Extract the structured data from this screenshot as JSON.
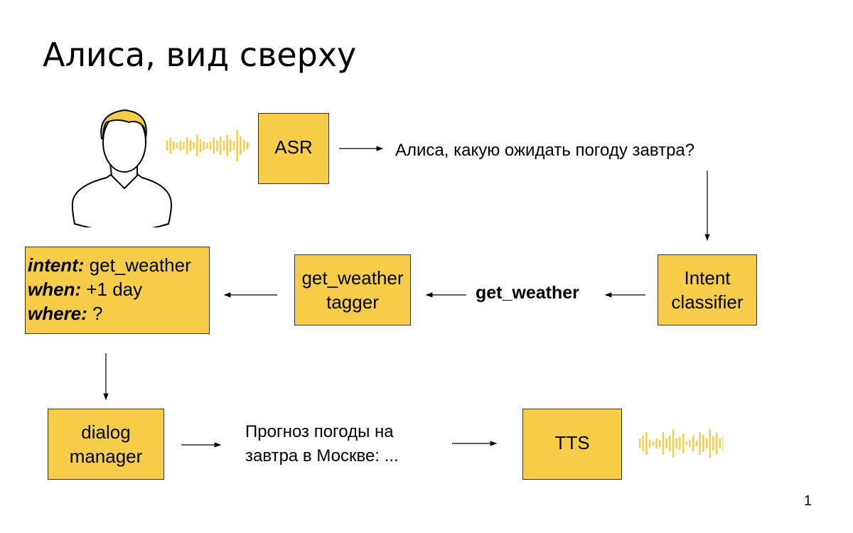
{
  "title": "Алиса, вид сверху",
  "accent_color": "#f6cd49",
  "nodes": {
    "asr": "ASR",
    "asr_output": "Алиса, какую ожидать погоду завтра?",
    "intent_classifier": "Intent classifier",
    "intent_line1": "Intent",
    "intent_line2": "classifier",
    "intent_output": "get_weather",
    "tagger_line1": "get_weather",
    "tagger_line2": "tagger",
    "frame": [
      {
        "key": "intent:",
        "value": " get_weather"
      },
      {
        "key": "when:",
        "value": " +1 day"
      },
      {
        "key": "where:",
        "value": " ?"
      }
    ],
    "dm_line1": "dialog",
    "dm_line2": "manager",
    "response_line1": "Прогноз погоды на",
    "response_line2": "завтра в Москве: ...",
    "tts": "TTS"
  },
  "icons": {
    "user": "user-icon",
    "input_wave": "sound-wave-icon",
    "output_wave": "sound-wave-icon"
  },
  "page_number": "1"
}
